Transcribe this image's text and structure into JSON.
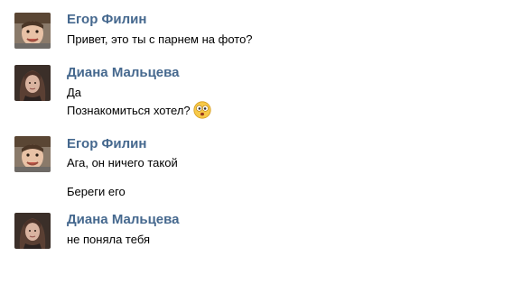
{
  "messages": [
    {
      "author": "Егор Филин",
      "lines": [
        "Привет, это ты с парнем на фото?"
      ]
    },
    {
      "author": "Диана Мальцева",
      "lines": [
        "Да",
        "Познакомиться хотел?"
      ],
      "emoji": "surprised-face-icon"
    },
    {
      "author": "Егор Филин",
      "lines": [
        "Ага, он ничего такой",
        "Береги его"
      ]
    },
    {
      "author": "Диана Мальцева",
      "lines": [
        "не поняла тебя"
      ]
    }
  ],
  "colors": {
    "author_link": "#45688e",
    "text": "#000000",
    "background": "#ffffff"
  }
}
